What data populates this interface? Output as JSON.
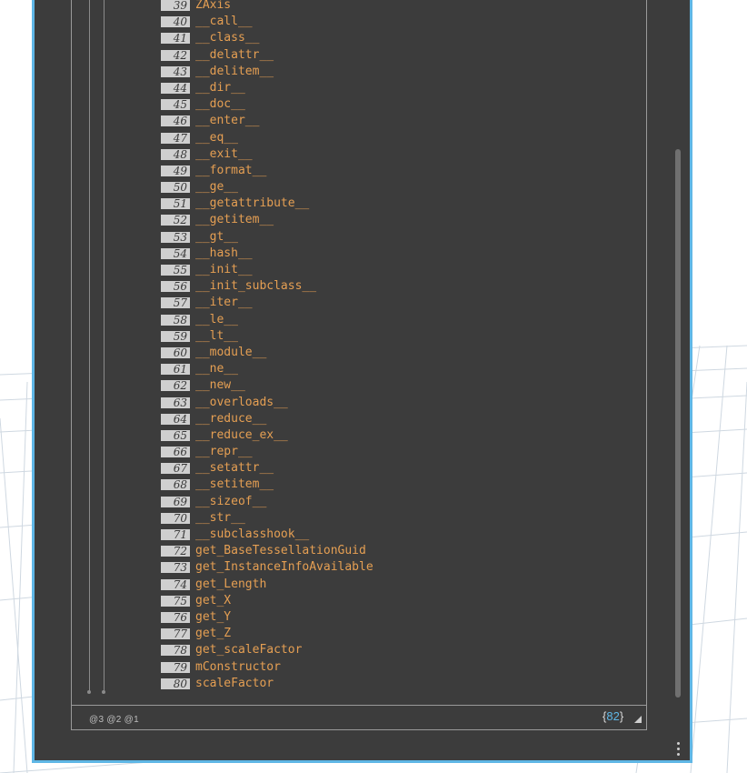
{
  "list": {
    "items": [
      {
        "index": "39",
        "value": "ZAxis"
      },
      {
        "index": "40",
        "value": "__call__"
      },
      {
        "index": "41",
        "value": "__class__"
      },
      {
        "index": "42",
        "value": "__delattr__"
      },
      {
        "index": "43",
        "value": "__delitem__"
      },
      {
        "index": "44",
        "value": "__dir__"
      },
      {
        "index": "45",
        "value": "__doc__"
      },
      {
        "index": "46",
        "value": "__enter__"
      },
      {
        "index": "47",
        "value": "__eq__"
      },
      {
        "index": "48",
        "value": "__exit__"
      },
      {
        "index": "49",
        "value": "__format__"
      },
      {
        "index": "50",
        "value": "__ge__"
      },
      {
        "index": "51",
        "value": "__getattribute__"
      },
      {
        "index": "52",
        "value": "__getitem__"
      },
      {
        "index": "53",
        "value": "__gt__"
      },
      {
        "index": "54",
        "value": "__hash__"
      },
      {
        "index": "55",
        "value": "__init__"
      },
      {
        "index": "56",
        "value": "__init_subclass__"
      },
      {
        "index": "57",
        "value": "__iter__"
      },
      {
        "index": "58",
        "value": "__le__"
      },
      {
        "index": "59",
        "value": "__lt__"
      },
      {
        "index": "60",
        "value": "__module__"
      },
      {
        "index": "61",
        "value": "__ne__"
      },
      {
        "index": "62",
        "value": "__new__"
      },
      {
        "index": "63",
        "value": "__overloads__"
      },
      {
        "index": "64",
        "value": "__reduce__"
      },
      {
        "index": "65",
        "value": "__reduce_ex__"
      },
      {
        "index": "66",
        "value": "__repr__"
      },
      {
        "index": "67",
        "value": "__setattr__"
      },
      {
        "index": "68",
        "value": "__setitem__"
      },
      {
        "index": "69",
        "value": "__sizeof__"
      },
      {
        "index": "70",
        "value": "__str__"
      },
      {
        "index": "71",
        "value": "__subclasshook__"
      },
      {
        "index": "72",
        "value": "get_BaseTessellationGuid"
      },
      {
        "index": "73",
        "value": "get_InstanceInfoAvailable"
      },
      {
        "index": "74",
        "value": "get_Length"
      },
      {
        "index": "75",
        "value": "get_X"
      },
      {
        "index": "76",
        "value": "get_Y"
      },
      {
        "index": "77",
        "value": "get_Z"
      },
      {
        "index": "78",
        "value": "get_scaleFactor"
      },
      {
        "index": "79",
        "value": "mConstructor"
      },
      {
        "index": "80",
        "value": "scaleFactor"
      }
    ]
  },
  "footer": {
    "levels": [
      "@3",
      "@2",
      "@1"
    ],
    "count_open": "{",
    "count": "82",
    "count_close": "}"
  },
  "icons": {
    "resize": "resize-corner-icon",
    "menu": "vertical-ellipsis-icon"
  },
  "colors": {
    "node_bg": "#3c3c3c",
    "selection_border": "#5fb7e6",
    "item_text": "#e59f53",
    "count_number": "#5fb7e6"
  }
}
